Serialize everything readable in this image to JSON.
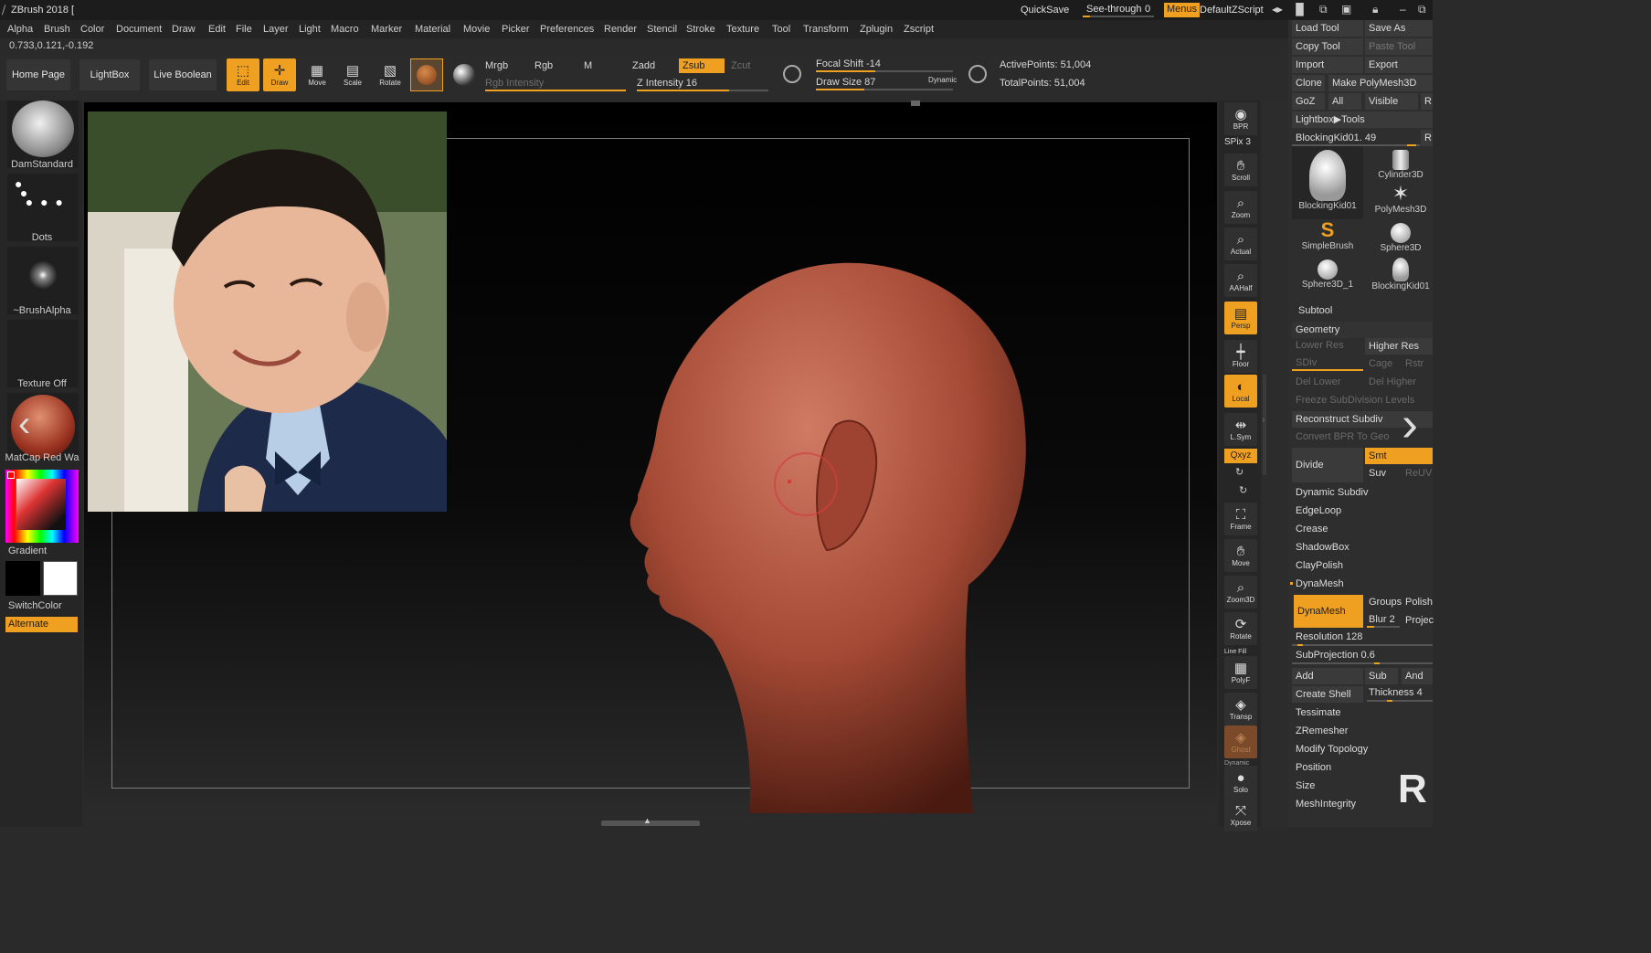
{
  "app": {
    "title": "ZBrush 2018 [",
    "quicksave": "QuickSave",
    "see_through": "See-through",
    "see_through_value": "0",
    "menus": "Menus",
    "default_script": "DefaultZScript"
  },
  "menus": [
    "Alpha",
    "Brush",
    "Color",
    "Document",
    "Draw",
    "Edit",
    "File",
    "Layer",
    "Light",
    "Macro",
    "Marker",
    "Material",
    "Movie",
    "Picker",
    "Preferences",
    "Render",
    "Stencil",
    "Stroke",
    "Texture",
    "Tool",
    "Transform",
    "Zplugin",
    "Zscript"
  ],
  "coords": "0.733,0.121,-0.192",
  "toolbar": {
    "home": "Home Page",
    "lightbox": "LightBox",
    "live_boolean": "Live Boolean",
    "edit": "Edit",
    "draw": "Draw",
    "move": "Move",
    "scale": "Scale",
    "rotate": "Rotate",
    "mrgb": "Mrgb",
    "rgb": "Rgb",
    "m": "M",
    "rgb_intensity": "Rgb Intensity",
    "zadd": "Zadd",
    "zsub": "Zsub",
    "zcut": "Zcut",
    "z_intensity": "Z Intensity 16",
    "focal_shift": "Focal Shift -14",
    "draw_size": "Draw Size 87",
    "dynamic": "Dynamic",
    "active_points": "ActivePoints: 51,004",
    "total_points": "TotalPoints: 51,004",
    "z_intensity_level": 0.7,
    "rgb_intensity_level": 1.0,
    "focal_shift_level": 0.43,
    "draw_size_level": 0.35
  },
  "left": {
    "brush": "DamStandard",
    "stroke": "Dots",
    "alpha": "~BrushAlpha",
    "texture": "Texture Off",
    "material": "MatCap Red Wa",
    "gradient": "Gradient",
    "switchcolor": "SwitchColor",
    "alternate": "Alternate"
  },
  "shelf": [
    {
      "name": "bpr",
      "label": "BPR"
    },
    {
      "name": "spix",
      "label": "SPix 3"
    },
    {
      "name": "scroll",
      "label": "Scroll"
    },
    {
      "name": "zoom",
      "label": "Zoom"
    },
    {
      "name": "actual",
      "label": "Actual"
    },
    {
      "name": "aahalf",
      "label": "AAHalf"
    },
    {
      "name": "persp",
      "label": "Persp"
    },
    {
      "name": "floor",
      "label": "Floor"
    },
    {
      "name": "local",
      "label": "Local"
    },
    {
      "name": "lsym",
      "label": "L.Sym"
    },
    {
      "name": "xyz",
      "label": "Qxyz"
    },
    {
      "name": "frame",
      "label": "Frame"
    },
    {
      "name": "move",
      "label": "Move"
    },
    {
      "name": "zoom3d",
      "label": "Zoom3D"
    },
    {
      "name": "rotate",
      "label": "Rotate"
    },
    {
      "name": "polyf",
      "label": "PolyF"
    },
    {
      "name": "transp",
      "label": "Transp"
    },
    {
      "name": "ghost",
      "label": "Ghost"
    },
    {
      "name": "solo",
      "label": "Solo"
    },
    {
      "name": "xpose",
      "label": "Xpose"
    }
  ],
  "shelf_small": {
    "dynamic": "Dynamic",
    "line_fill": "Line Fill"
  },
  "tray": {
    "load_tool": "Load Tool",
    "save_as": "Save As",
    "copy_tool": "Copy Tool",
    "paste_tool": "Paste Tool",
    "import": "Import",
    "export": "Export",
    "clone": "Clone",
    "make_polymesh": "Make PolyMesh3D",
    "goz": "GoZ",
    "all": "All",
    "visible": "Visible",
    "r": "R",
    "lightbox_tools": "Lightbox▶Tools",
    "current_tool": "BlockingKid01. 49",
    "tools": [
      "BlockingKid01",
      "Cylinder3D",
      "PolyMesh3D",
      "SimpleBrush",
      "Sphere3D",
      "Sphere3D_1",
      "BlockingKid01"
    ],
    "subtool": "Subtool",
    "geometry": "Geometry",
    "lower_res": "Lower Res",
    "higher_res": "Higher Res",
    "sdiv": "SDiv",
    "cage": "Cage",
    "rstr": "Rstr",
    "del_lower": "Del Lower",
    "del_higher": "Del Higher",
    "freeze": "Freeze SubDivision Levels",
    "reconstruct": "Reconstruct Subdiv",
    "convert_bpr": "Convert BPR To Geo",
    "divide": "Divide",
    "smt": "Smt",
    "suv": "Suv",
    "reuv": "ReUV",
    "items": [
      "Dynamic Subdiv",
      "EdgeLoop",
      "Crease",
      "ShadowBox",
      "ClayPolish",
      "DynaMesh"
    ],
    "dynamesh_btn": "DynaMesh",
    "groups": "Groups",
    "polish": "Polish",
    "blur": "Blur 2",
    "project": "Projec",
    "resolution": "Resolution 128",
    "subprojection": "SubProjection 0.6",
    "add": "Add",
    "sub": "Sub",
    "and": "And",
    "create_shell": "Create Shell",
    "thickness": "Thickness 4",
    "items2": [
      "Tessimate",
      "ZRemesher",
      "Modify Topology",
      "Position",
      "Size",
      "MeshIntegrity"
    ]
  }
}
